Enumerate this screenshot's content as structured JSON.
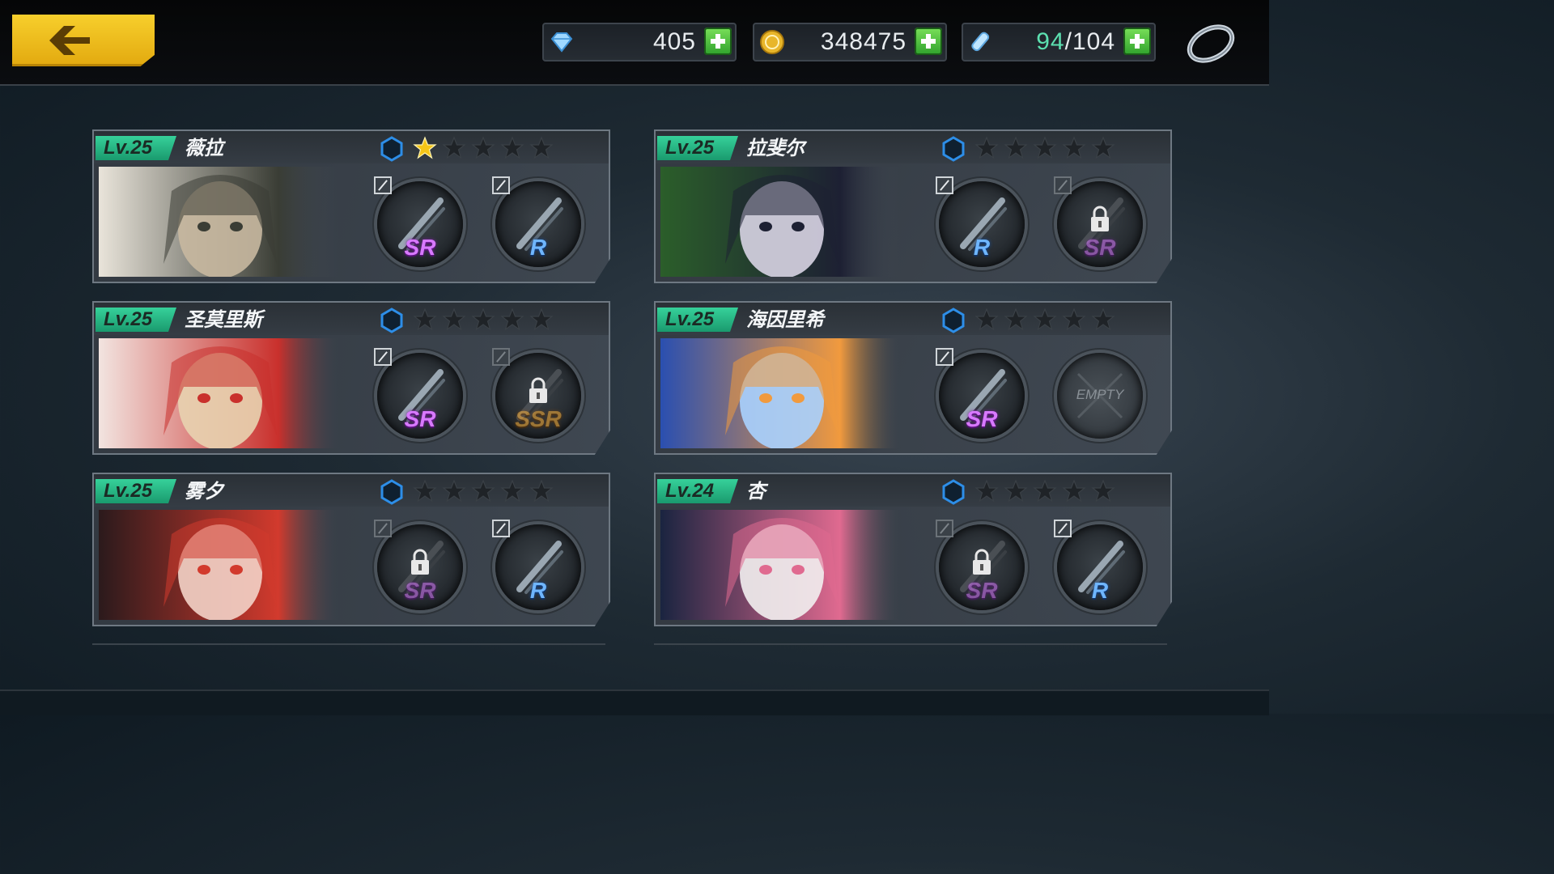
{
  "header": {
    "gems": "405",
    "gold": "348475",
    "stamina_current": "94",
    "stamina_max": "/104"
  },
  "characters": [
    {
      "level": "Lv.25",
      "name": "薇拉",
      "stars_filled": 1,
      "slots": [
        {
          "rarity": "SR",
          "locked": false
        },
        {
          "rarity": "R",
          "locked": false
        }
      ]
    },
    {
      "level": "Lv.25",
      "name": "拉斐尔",
      "stars_filled": 0,
      "slots": [
        {
          "rarity": "R",
          "locked": false
        },
        {
          "rarity": "SR",
          "locked": true
        }
      ]
    },
    {
      "level": "Lv.25",
      "name": "圣莫里斯",
      "stars_filled": 0,
      "slots": [
        {
          "rarity": "SR",
          "locked": false
        },
        {
          "rarity": "SSR",
          "locked": true
        }
      ]
    },
    {
      "level": "Lv.25",
      "name": "海因里希",
      "stars_filled": 0,
      "slots": [
        {
          "rarity": "SR",
          "locked": false
        },
        {
          "rarity": "EMPTY",
          "locked": false
        }
      ]
    },
    {
      "level": "Lv.25",
      "name": "雾夕",
      "stars_filled": 0,
      "slots": [
        {
          "rarity": "SR",
          "locked": true
        },
        {
          "rarity": "R",
          "locked": false
        }
      ]
    },
    {
      "level": "Lv.24",
      "name": "杏",
      "stars_filled": 0,
      "slots": [
        {
          "rarity": "SR",
          "locked": true
        },
        {
          "rarity": "R",
          "locked": false
        }
      ]
    }
  ],
  "colors": {
    "level_badge": "#36d19a",
    "star_gold": "#f5c518",
    "star_empty": "#1f2327",
    "sr": "#d879ff",
    "r": "#6fb6ff",
    "ssr": "#ffb23a"
  }
}
